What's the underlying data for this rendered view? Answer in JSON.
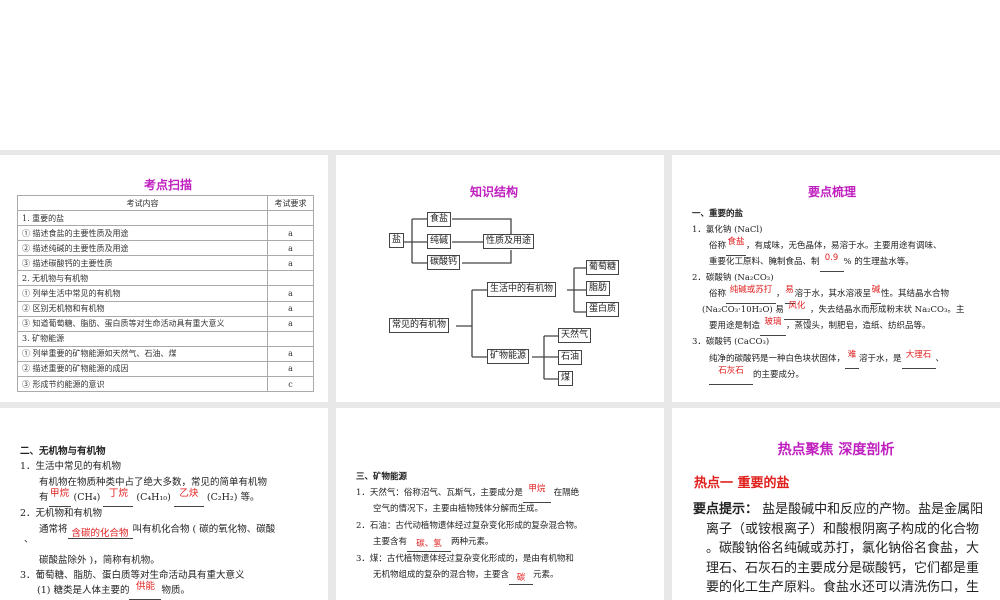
{
  "scan": {
    "title": "考点扫描",
    "headers": [
      "考试内容",
      "考试要求"
    ],
    "rows": [
      [
        "1. 重要的盐",
        ""
      ],
      [
        "① 描述食盐的主要性质及用途",
        "a"
      ],
      [
        "② 描述纯碱的主要性质及用途",
        "a"
      ],
      [
        "③ 描述碳酸钙的主要性质",
        "a"
      ],
      [
        "2. 无机物与有机物",
        ""
      ],
      [
        "① 列举生活中常见的有机物",
        "a"
      ],
      [
        "② 区别无机物和有机物",
        "a"
      ],
      [
        "③ 知道葡萄糖、脂肪、蛋白质等对生命活动具有重大意义",
        "a"
      ],
      [
        "3. 矿物能源",
        ""
      ],
      [
        "① 列举重要的矿物能源如天然气、石油、煤",
        "a"
      ],
      [
        "② 描述重要的矿物能源的成因",
        "a"
      ],
      [
        "③ 形成节约能源的意识",
        "c"
      ]
    ]
  },
  "structure": {
    "title": "知识结构",
    "salt": "盐",
    "table_salt": "食盐",
    "soda": "纯碱",
    "caco3": "碳酸钙",
    "props": "性质及用途",
    "organic": "常见的有机物",
    "life": "生活中的有机物",
    "glucose": "葡萄糖",
    "fat": "脂肪",
    "protein": "蛋白质",
    "mineral": "矿物能源",
    "gas": "天然气",
    "oil": "石油",
    "coal": "煤"
  },
  "key": {
    "title": "要点梳理",
    "h1": "一、重要的盐",
    "nacl_h": "1．氯化钠 (NaCl)",
    "nacl_1a": "俗称",
    "nacl_1b": "食盐",
    "nacl_1c": "，有咸味，无色晶体，易溶于水。主要用途有调味、",
    "nacl_2a": "重要化工原料、腌制食品、制",
    "nacl_2b": "0.9",
    "nacl_2c": "% 的生理盐水等。",
    "na2co3_h": "2．碳酸钠 (Na₂CO₃)",
    "n1a": "俗称",
    "n1b": "纯碱或苏打",
    "n1c": "，",
    "n1d": "易",
    "n1e": "溶于水，其水溶液呈",
    "n1f": "碱",
    "n1g": "性。其结晶水合物",
    "n2a": "(Na₂CO₃·10H₂O) 易",
    "n2b": "风化",
    "n2c": "，失去结晶水而形成粉末状 Na₂CO₃。主",
    "n3a": "要用途是制造",
    "n3b": "玻璃",
    "n3c": "，蒸馒头，制肥皂，造纸、纺织品等。",
    "caco3_h": "3．碳酸钙 (CaCO₃)",
    "c1a": "纯净的碳酸钙是一种白色块状固体，",
    "c1b": "难",
    "c1c": "溶于水，是",
    "c1d": "大理石",
    "c1e": "、",
    "c2a": "石灰石",
    "c2b": "的主要成分。"
  },
  "organic": {
    "h": "二、无机物与有机物",
    "s1": "1．生活中常见的有机物",
    "p1": "有机物在物质种类中占了绝大多数，常见的简单有机物",
    "p2a": "有",
    "p2b": "甲烷",
    "p2c": "(CH₄)",
    "p2d": "丁烷",
    "p2e": "(C₄H₁₀)",
    "p2f": "乙炔",
    "p2g": "(C₂H₂) 等。",
    "s2": "2．无机物和有机物",
    "p3a": "通常将",
    "p3b": "含碳的化合物",
    "p3c": "叫有机化合物 ( 碳的氧化物、碳酸",
    "p3d": "、",
    "p4": "碳酸盐除外 )，简称有机物。",
    "s3": "3．葡萄糖、脂肪、蛋白质等对生命活动具有重大意义",
    "p5a": "(1) 糖类是人体主要的",
    "p5b": "供能",
    "p5c": "物质。"
  },
  "energy": {
    "h": "三、矿物能源",
    "a1": "1．天然气：俗称沼气、瓦斯气，主要成分是",
    "a1b": "甲烷",
    "a1c": " 在隔绝",
    "a2": "空气的情况下，主要由植物残体分解而生成。",
    "b1": "2．石油：古代动植物遗体经过复杂变化形成的复杂混合物。",
    "b2a": "主要含有",
    "b2b": "碳、氢",
    "b2c": "两种元素。",
    "c1": "3．煤：古代植物遗体经过复杂变化形成的，是由有机物和",
    "c2a": "无机物组成的复杂的混合物，主要含",
    "c2b": "碳",
    "c2c": "元素。"
  },
  "hot": {
    "title": "热点聚焦  深度剖析",
    "sub": "热点一    重要的盐",
    "label": "要点提示：",
    "text": " 盐是酸碱中和反应的产物。盐是金属阳离子（或铵根离子）和酸根阴离子构成的化合物。碳酸钠俗名纯碱或苏打，氯化钠俗名食盐，大理石、石灰石的主要成分是碳酸钙，它们都是重要的化工生产原料。食盐水还可以清洗伤口，生"
  }
}
